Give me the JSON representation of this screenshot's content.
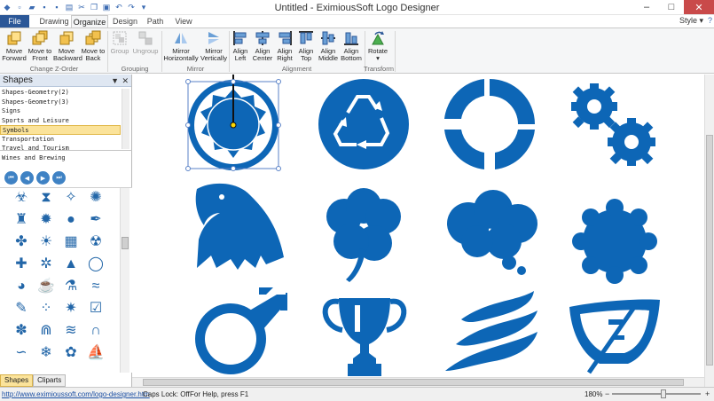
{
  "window": {
    "title": "Untitled - EximiousSoft Logo Designer",
    "minimize": "–",
    "maximize": "□",
    "close": "✕"
  },
  "ribbon_tabs": {
    "file": "File",
    "drawing": "Drawing",
    "organize": "Organize",
    "design": "Design",
    "path": "Path",
    "view": "View",
    "style": "Style ▾",
    "help": "?"
  },
  "ribbon": {
    "buttons": {
      "move_forward": "Move Forward",
      "move_to_front": "Move to Front",
      "move_backward": "Move Backward",
      "move_to_back": "Move to Back",
      "group": "Group",
      "ungroup": "Ungroup",
      "mirror_h": "Mirror Horizontally",
      "mirror_v": "Mirror Vertically",
      "align_left": "Align Left",
      "align_center": "Align Center",
      "align_right": "Align Right",
      "align_top": "Align Top",
      "align_middle": "Align Middle",
      "align_bottom": "Align Bottom",
      "rotate": "Rotate"
    },
    "groups": {
      "z_order": "Change Z-Order",
      "grouping": "Grouping",
      "mirror": "Mirror",
      "alignment": "Alignment",
      "transform": "Transform"
    }
  },
  "left_panel": {
    "title": "Shapes",
    "categories": [
      "Shapes-Geometry(2)",
      "Shapes-Geometry(3)",
      "Signs",
      "Sports and Leisure",
      "Symbols",
      "Transportation",
      "Travel and Tourism",
      "Wines and Brewing"
    ],
    "selected_category": "Symbols",
    "tabs": [
      "Shapes",
      "Cliparts"
    ],
    "active_tab": "Shapes"
  },
  "status": {
    "link": "http://www.eximioussoft.com/logo-designer.htm",
    "caps": "Caps Lock: Off",
    "help": "For Help, press F1",
    "zoom": "180%",
    "zoom_level": 0.58
  },
  "colors": {
    "accent": "#2b5797",
    "logo_blue": "#0d66b6",
    "selected_category": "#fbe39a"
  }
}
